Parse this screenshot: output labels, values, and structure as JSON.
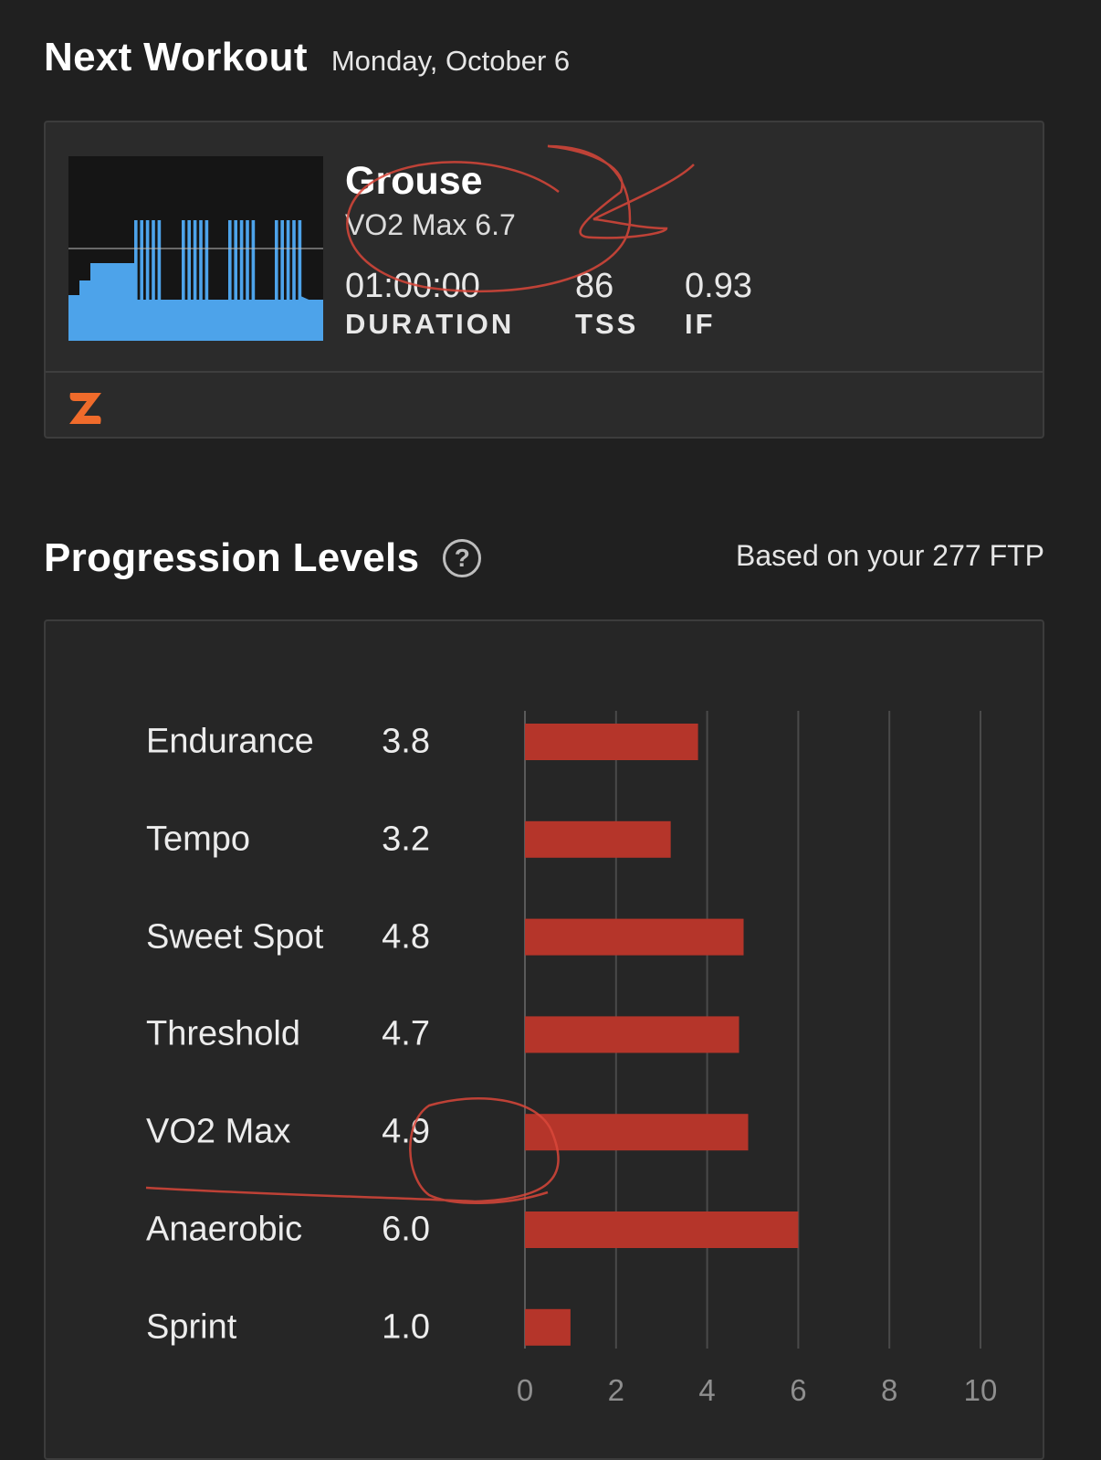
{
  "next_workout": {
    "heading": "Next Workout",
    "date": "Monday, October 6",
    "name": "Grouse",
    "subtitle": "VO2 Max 6.7",
    "metrics": [
      {
        "value": "01:00:00",
        "label": "DURATION"
      },
      {
        "value": "86",
        "label": "TSS"
      },
      {
        "value": "0.93",
        "label": "IF"
      }
    ],
    "graph_color": "#4da3ea",
    "logo": "zwift-logo-icon",
    "logo_color": "#f06b2b"
  },
  "progression": {
    "heading": "Progression Levels",
    "help_icon_glyph": "?",
    "ftp_note": "Based on your 277 FTP"
  },
  "chart_data": {
    "type": "bar",
    "orientation": "horizontal",
    "categories": [
      "Endurance",
      "Tempo",
      "Sweet Spot",
      "Threshold",
      "VO2 Max",
      "Anaerobic",
      "Sprint"
    ],
    "values": [
      3.8,
      3.2,
      4.8,
      4.7,
      4.9,
      6.0,
      1.0
    ],
    "value_labels": [
      "3.8",
      "3.2",
      "4.8",
      "4.7",
      "4.9",
      "6.0",
      "1.0"
    ],
    "xlim": [
      0,
      10
    ],
    "xticks": [
      "0",
      "2",
      "4",
      "6",
      "8",
      "10"
    ],
    "bar_color": "#b5352a",
    "grid": true
  }
}
